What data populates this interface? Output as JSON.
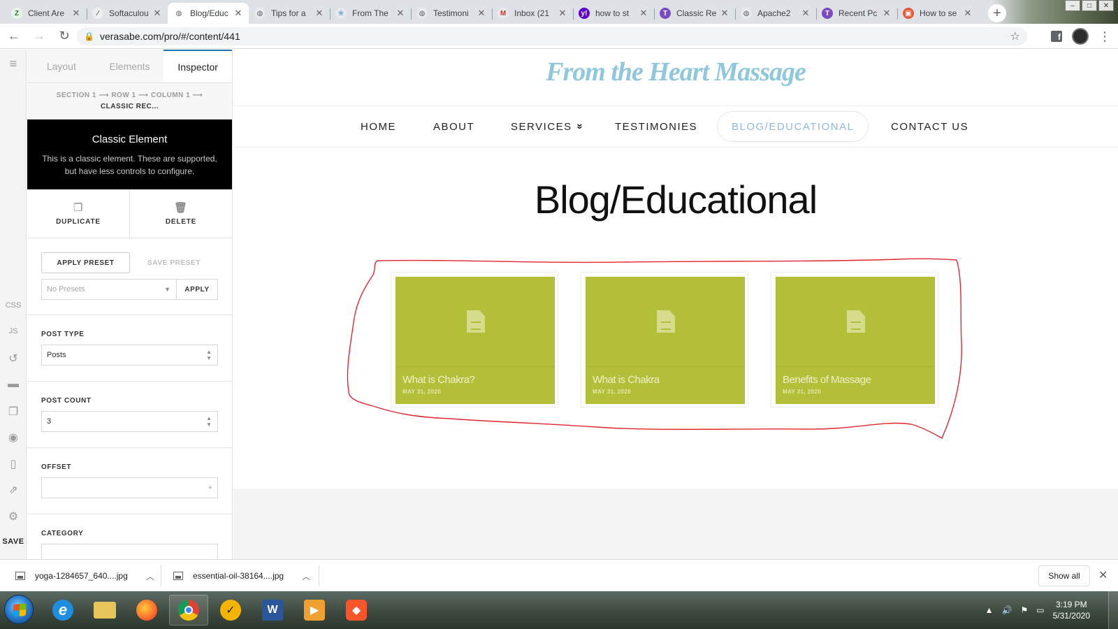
{
  "browser": {
    "tabs": [
      {
        "title": "Client Are",
        "fav": "Z",
        "fav_color": "#2e7d32",
        "fav_bg": "#e8f5e9",
        "active": false
      },
      {
        "title": "Softaculou",
        "fav": "∕",
        "fav_color": "#555555",
        "fav_bg": "#eeeeee",
        "active": false
      },
      {
        "title": "Blog/Educ",
        "fav": "◍",
        "fav_color": "#5f6368",
        "fav_bg": "#ffffff",
        "active": true
      },
      {
        "title": "Tips for a",
        "fav": "◍",
        "fav_color": "#5f6368",
        "fav_bg": "#e8eaed",
        "active": false
      },
      {
        "title": "From The",
        "fav": "❀",
        "fav_color": "#6fa8c9",
        "fav_bg": "#e8eaed",
        "active": false
      },
      {
        "title": "Testimoni",
        "fav": "◍",
        "fav_color": "#5f6368",
        "fav_bg": "#e8eaed",
        "active": false
      },
      {
        "title": "Inbox (21",
        "fav": "M",
        "fav_color": "#d93025",
        "fav_bg": "#e8eaed",
        "active": false
      },
      {
        "title": "how to st",
        "fav": "y!",
        "fav_color": "#ffffff",
        "fav_bg": "#6001d2",
        "active": false
      },
      {
        "title": "Classic Re",
        "fav": "T",
        "fav_color": "#ffffff",
        "fav_bg": "#7b4bbf",
        "active": false
      },
      {
        "title": "Apache2",
        "fav": "◍",
        "fav_color": "#5f6368",
        "fav_bg": "#e8eaed",
        "active": false
      },
      {
        "title": "Recent Pc",
        "fav": "T",
        "fav_color": "#ffffff",
        "fav_bg": "#7b4bbf",
        "active": false
      },
      {
        "title": "How to se",
        "fav": "▣",
        "fav_color": "#ffffff",
        "fav_bg": "#e8593a",
        "active": false
      }
    ],
    "url": "verasabe.com/pro/#/content/441",
    "icons": {
      "back": "←",
      "forward": "→",
      "reload": "↻",
      "lock": "🔒",
      "star": "☆",
      "menu": "⋮",
      "new_tab": "+",
      "close": "✕"
    }
  },
  "rail": {
    "css": "CSS",
    "js": "JS",
    "save": "SAVE"
  },
  "panel": {
    "tabs": [
      "Layout",
      "Elements",
      "Inspector"
    ],
    "breadcrumb_path": "SECTION 1 ⟶ ROW 1 ⟶ COLUMN 1 ⟶",
    "breadcrumb_current": "CLASSIC REC...",
    "element_title": "Classic Element",
    "element_desc": "This is a classic element. These are supported, but have less controls to configure.",
    "duplicate": "DUPLICATE",
    "delete": "DELETE",
    "apply_preset": "APPLY PRESET",
    "save_preset": "SAVE PRESET",
    "preset_placeholder": "No Presets",
    "apply": "APPLY",
    "post_type_label": "POST TYPE",
    "post_type_value": "Posts",
    "post_count_label": "POST COUNT",
    "post_count_value": "3",
    "offset_label": "OFFSET",
    "offset_value": "",
    "category_label": "CATEGORY"
  },
  "site": {
    "title": "From the Heart Massage",
    "nav": [
      "HOME",
      "ABOUT",
      "SERVICES",
      "TESTIMONIES",
      "BLOG/EDUCATIONAL",
      "CONTACT US"
    ],
    "nav_active": "BLOG/EDUCATIONAL",
    "nav_caret": "»",
    "heading": "Blog/Educational",
    "posts": [
      {
        "title": "What is Chakra?",
        "date": "MAY 31, 2020"
      },
      {
        "title": "What is Chakra",
        "date": "MAY 31, 2020"
      },
      {
        "title": "Benefits of Massage",
        "date": "MAY 31, 2020"
      }
    ],
    "colors": {
      "title": "#8fc7dd",
      "nav_active": "#8fb9e0",
      "card": "#b4bf39",
      "annotation": "#e0262e"
    }
  },
  "downloads": {
    "items": [
      "yoga-1284657_640....jpg",
      "essential-oil-38164....jpg"
    ],
    "show_all": "Show all"
  },
  "taskbar": {
    "time": "3:19 PM",
    "date": "5/31/2020"
  }
}
